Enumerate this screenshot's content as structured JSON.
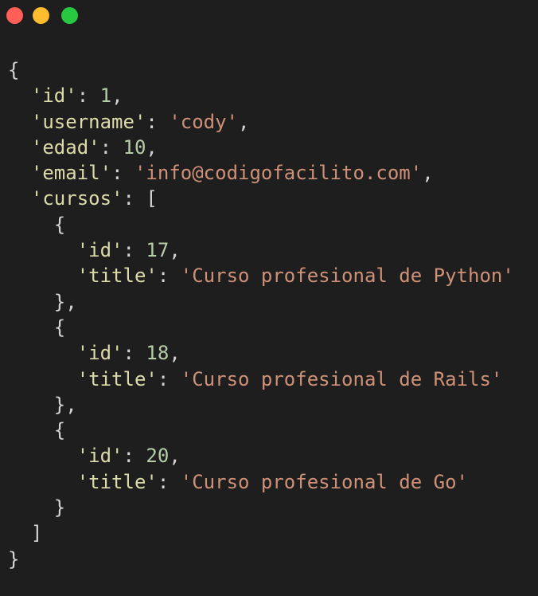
{
  "window": {
    "colors": {
      "background": "#1e1e1e",
      "close": "#ff5f57",
      "minimize": "#febc2e",
      "maximize": "#28c840",
      "key": "#dcdcaa",
      "string": "#ce9178",
      "number": "#b5cea8",
      "punctuation": "#d4d4d4"
    }
  },
  "code": {
    "open_brace": "{",
    "close_brace": "}",
    "id_key": "'id'",
    "id_value": "1",
    "username_key": "'username'",
    "username_value": "'cody'",
    "edad_key": "'edad'",
    "edad_value": "10",
    "email_key": "'email'",
    "email_value": "'info@codigofacilito.com'",
    "cursos_key": "'cursos'",
    "list_open": "[",
    "list_close": "]",
    "cursos": [
      {
        "id_key": "'id'",
        "id": "17",
        "title_key": "'title'",
        "title": "'Curso profesional de Python'"
      },
      {
        "id_key": "'id'",
        "id": "18",
        "title_key": "'title'",
        "title": "'Curso profesional de Rails'"
      },
      {
        "id_key": "'id'",
        "id": "20",
        "title_key": "'title'",
        "title": "'Curso profesional de Go'"
      }
    ]
  }
}
